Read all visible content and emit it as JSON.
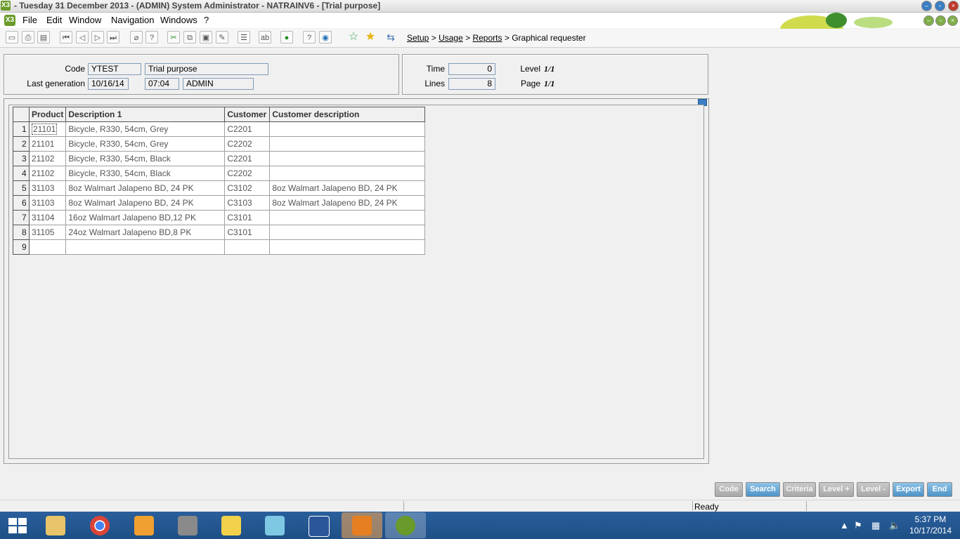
{
  "window": {
    "title": "- Tuesday 31 December 2013 - (ADMIN) System Administrator - NATRAINV6 - [Trial purpose]",
    "logo": "X3"
  },
  "menu": {
    "items": [
      {
        "label": "File"
      },
      {
        "label": "Edit"
      },
      {
        "label": "Window"
      },
      {
        "label": "Navigation"
      },
      {
        "label": "Windows"
      },
      {
        "label": "?"
      }
    ]
  },
  "breadcrumb": {
    "items": [
      "Setup",
      "Usage",
      "Reports"
    ],
    "current": "Graphical requester",
    "separator": ">"
  },
  "header": {
    "code_label": "Code",
    "code_value": "YTEST",
    "code_desc": "Trial purpose",
    "lastgen_label": "Last generation",
    "lastgen_date": "10/16/14",
    "lastgen_time": "07:04",
    "lastgen_user": "ADMIN",
    "time_label": "Time",
    "time_value": "0",
    "lines_label": "Lines",
    "lines_value": "8",
    "level_label": "Level",
    "level_value": "1/1",
    "page_label": "Page",
    "page_value": "1/1"
  },
  "grid": {
    "columns": [
      "Product",
      "Description 1",
      "Customer",
      "Customer description"
    ],
    "rows": [
      {
        "n": "1",
        "product": "21101",
        "desc": "Bicycle, R330, 54cm, Grey",
        "customer": "C2201",
        "cdesc": ""
      },
      {
        "n": "2",
        "product": "21101",
        "desc": "Bicycle, R330, 54cm, Grey",
        "customer": "C2202",
        "cdesc": ""
      },
      {
        "n": "3",
        "product": "21102",
        "desc": "Bicycle, R330, 54cm, Black",
        "customer": "C2201",
        "cdesc": ""
      },
      {
        "n": "4",
        "product": "21102",
        "desc": "Bicycle, R330, 54cm, Black",
        "customer": "C2202",
        "cdesc": ""
      },
      {
        "n": "5",
        "product": "31103",
        "desc": "8oz Walmart Jalapeno BD, 24 PK",
        "customer": "C3102",
        "cdesc": "8oz Walmart Jalapeno BD, 24 PK"
      },
      {
        "n": "6",
        "product": "31103",
        "desc": "8oz Walmart Jalapeno BD, 24 PK",
        "customer": "C3103",
        "cdesc": "8oz Walmart Jalapeno BD, 24 PK"
      },
      {
        "n": "7",
        "product": "31104",
        "desc": "16oz Walmart Jalapeno BD,12 PK",
        "customer": "C3101",
        "cdesc": ""
      },
      {
        "n": "8",
        "product": "31105",
        "desc": "24oz Walmart Jalapeno BD,8 PK",
        "customer": "C3101",
        "cdesc": ""
      },
      {
        "n": "9",
        "product": "",
        "desc": "",
        "customer": "",
        "cdesc": ""
      }
    ]
  },
  "buttons": {
    "code": "Code",
    "search": "Search",
    "criteria": "Criteria",
    "level_plus": "Level +",
    "level_minus": "Level -",
    "export": "Export",
    "end": "End"
  },
  "status": {
    "text": "Ready"
  },
  "taskbar": {
    "time": "5:37 PM",
    "date": "10/17/2014"
  },
  "colors": {
    "button_enabled": "#4d93c7",
    "button_disabled": "#a9a9a9",
    "taskbar": "#1e4f86",
    "x3_green": "#6a9a2a"
  }
}
